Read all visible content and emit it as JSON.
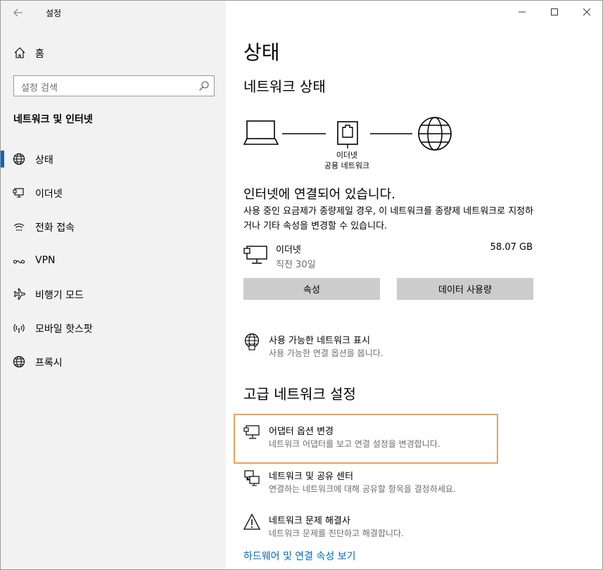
{
  "window": {
    "title": "설정",
    "accent": "#0067c0",
    "focus_color": "#e8a15a"
  },
  "sidebar": {
    "home_label": "홈",
    "search_placeholder": "설정 검색",
    "section_title": "네트워크 및 인터넷",
    "items": [
      {
        "label": "상태",
        "icon": "globe-icon",
        "active": true
      },
      {
        "label": "이더넷",
        "icon": "ethernet-icon",
        "active": false
      },
      {
        "label": "전화 접속",
        "icon": "dialup-icon",
        "active": false
      },
      {
        "label": "VPN",
        "icon": "vpn-icon",
        "active": false
      },
      {
        "label": "비행기 모드",
        "icon": "airplane-icon",
        "active": false
      },
      {
        "label": "모바일 핫스팟",
        "icon": "hotspot-icon",
        "active": false
      },
      {
        "label": "프록시",
        "icon": "proxy-globe-icon",
        "active": false
      }
    ]
  },
  "main": {
    "page_title": "상태",
    "network_status_heading": "네트워크 상태",
    "diagram": {
      "caption_line1": "이더넷",
      "caption_line2": "공용 네트워크"
    },
    "connection_title": "인터넷에 연결되어 있습니다.",
    "connection_desc": "사용 중인 요금제가 종량제일 경우, 이 네트워크를 종량제 네트워크로 지정하거나 기타 속성을 변경할 수 있습니다.",
    "ethernet": {
      "name": "이더넷",
      "time": "직전 30일",
      "usage": "58.07 GB"
    },
    "buttons": {
      "properties": "속성",
      "data_usage": "데이터 사용량"
    },
    "show_networks": {
      "title": "사용 가능한 네트워크 표시",
      "sub": "사용 가능한 연결 옵션을 봅니다."
    },
    "advanced_heading": "고급 네트워크 설정",
    "adapter": {
      "title": "어댑터 옵션 변경",
      "sub": "네트워크 어댑터를 보고 연결 설정을 변경합니다."
    },
    "sharing_center": {
      "title": "네트워크 및 공유 센터",
      "sub": "연결하는 네트워크에 대해 공유할 항목을 결정하세요."
    },
    "troubleshooter": {
      "title": "네트워크 문제 해결사",
      "sub": "네트워크 문제를 진단하고 해결합니다."
    },
    "hardware_link": "하드웨어 및 연결 속성 보기"
  }
}
